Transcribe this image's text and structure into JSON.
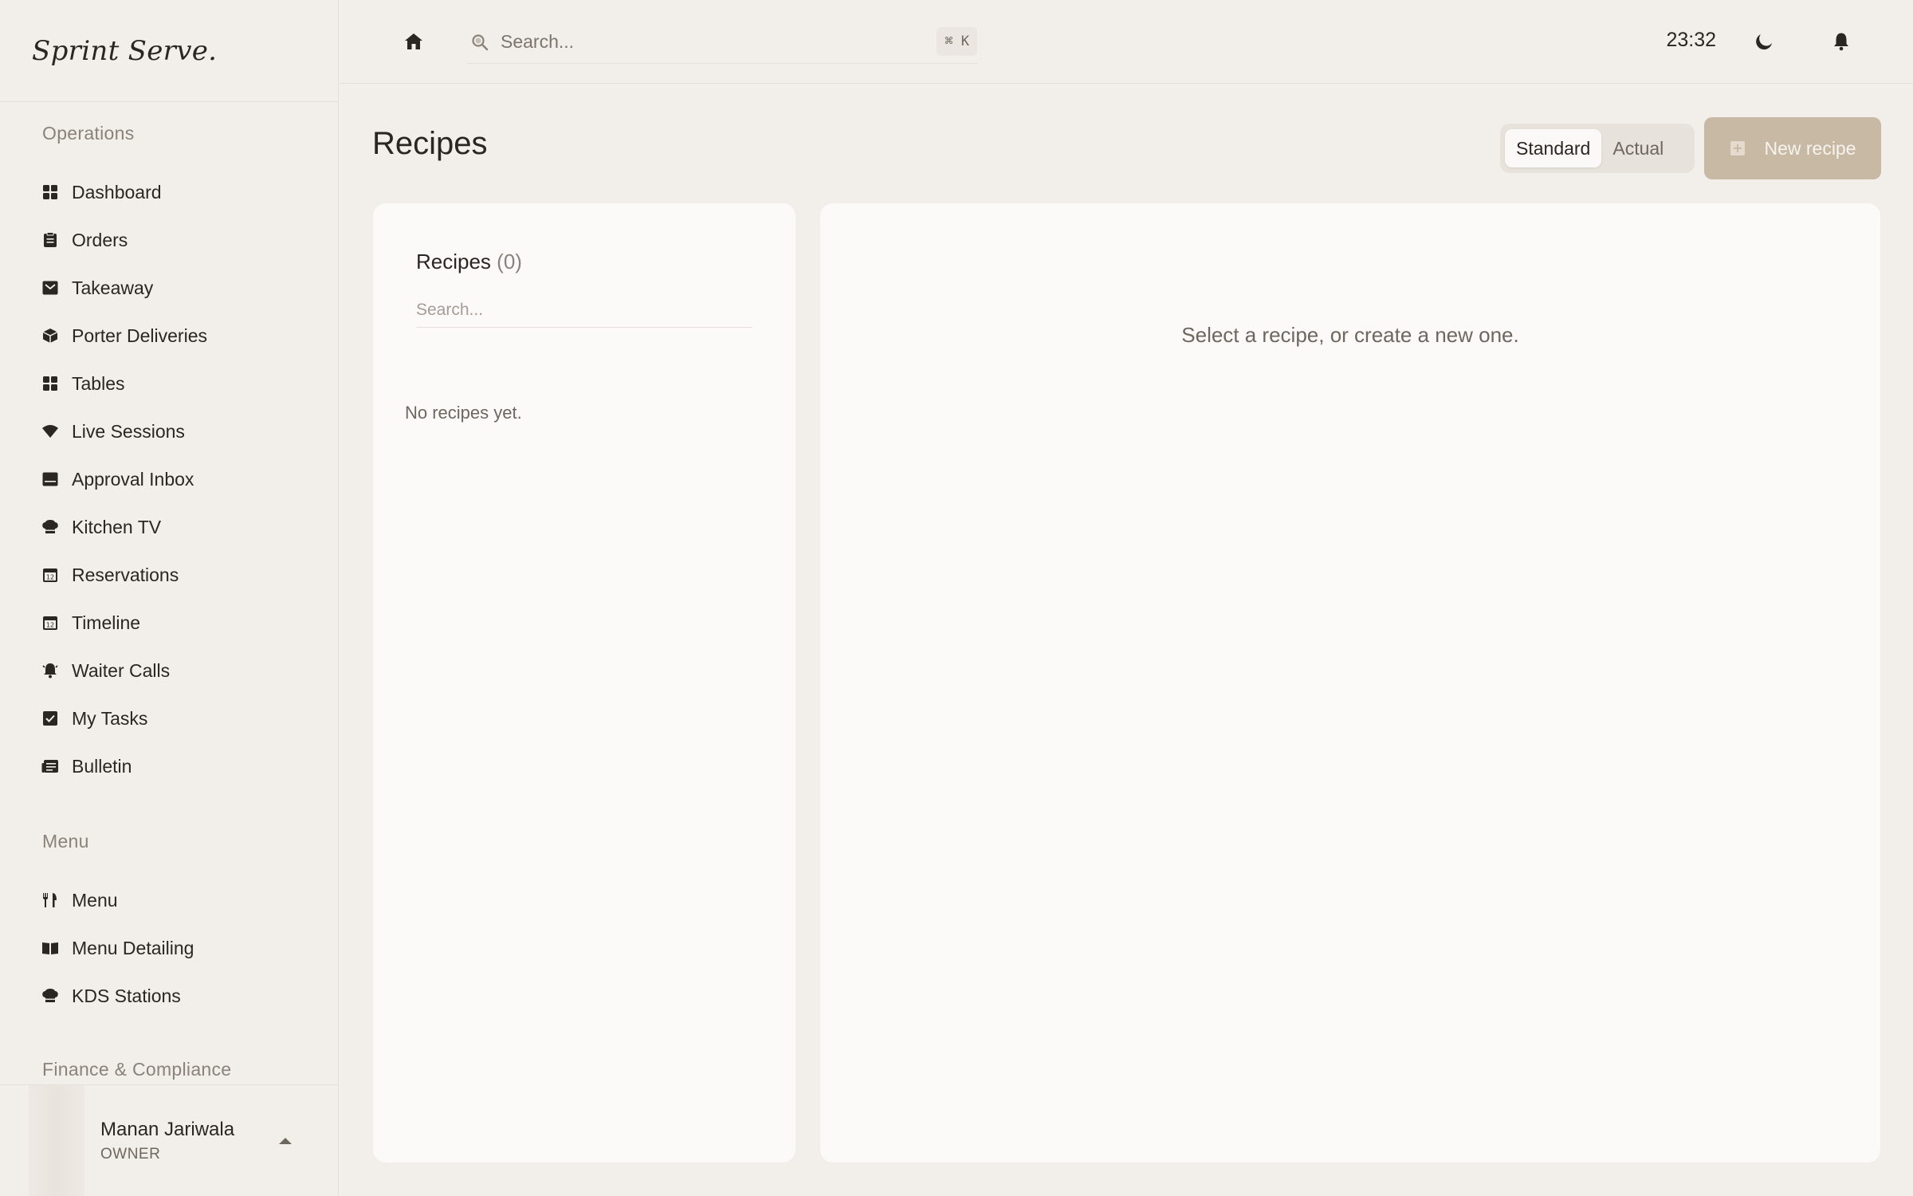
{
  "brand": "Sprint Serve.",
  "sidebar": {
    "sections": [
      {
        "title": "Operations",
        "items": [
          {
            "label": "Dashboard",
            "icon": "grid-icon"
          },
          {
            "label": "Orders",
            "icon": "clipboard-icon"
          },
          {
            "label": "Takeaway",
            "icon": "takeaway-box-icon"
          },
          {
            "label": "Porter Deliveries",
            "icon": "package-icon"
          },
          {
            "label": "Tables",
            "icon": "tables-grid-icon"
          },
          {
            "label": "Live Sessions",
            "icon": "wifi-icon"
          },
          {
            "label": "Approval Inbox",
            "icon": "inbox-icon"
          },
          {
            "label": "Kitchen TV",
            "icon": "chef-hat-icon"
          },
          {
            "label": "Reservations",
            "icon": "calendar-icon"
          },
          {
            "label": "Timeline",
            "icon": "calendar-icon"
          },
          {
            "label": "Waiter Calls",
            "icon": "bell-ring-icon"
          },
          {
            "label": "My Tasks",
            "icon": "check-square-icon"
          },
          {
            "label": "Bulletin",
            "icon": "newspaper-icon"
          }
        ]
      },
      {
        "title": "Menu",
        "items": [
          {
            "label": "Menu",
            "icon": "utensils-icon"
          },
          {
            "label": "Menu Detailing",
            "icon": "book-open-icon"
          },
          {
            "label": "KDS Stations",
            "icon": "chef-hat-icon"
          }
        ]
      },
      {
        "title": "Finance & Compliance",
        "items": []
      }
    ]
  },
  "user": {
    "name": "Manan Jariwala",
    "role": "OWNER"
  },
  "topbar": {
    "search_placeholder": "Search...",
    "shortcut": "⌘ K",
    "time": "23:32"
  },
  "page": {
    "title": "Recipes",
    "toggle": {
      "options": [
        "Standard",
        "Actual"
      ],
      "selected": "Standard"
    },
    "new_button": "New recipe"
  },
  "list_panel": {
    "title": "Recipes",
    "count": "(0)",
    "search_placeholder": "Search...",
    "empty_text": "No recipes yet."
  },
  "detail_panel": {
    "empty_text": "Select a recipe, or create a new one."
  },
  "colors": {
    "background": "#f2eeea",
    "panel": "#fbfaf8",
    "accent_button": "#c8b9a5",
    "text": "#2b2622",
    "muted": "#8a827b"
  }
}
